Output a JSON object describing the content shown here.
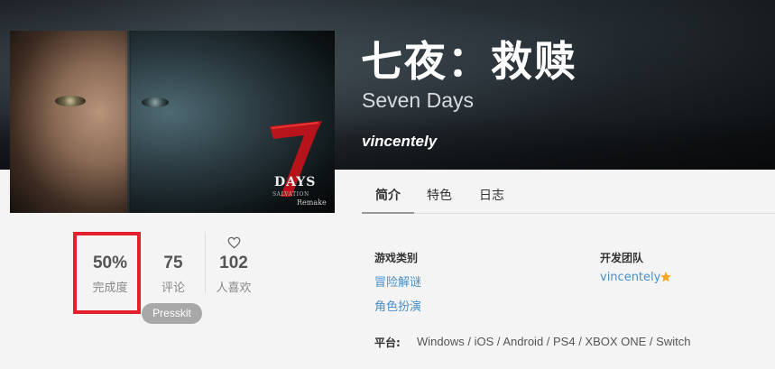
{
  "game": {
    "title": "七夜：救赎",
    "subtitle": "Seven Days",
    "author": "vincentely",
    "cover_logo": {
      "numeral": "7",
      "days": "DAYS",
      "sub": "SALVATION",
      "remake": "Remake"
    }
  },
  "tabs": [
    {
      "label": "简介",
      "active": true
    },
    {
      "label": "特色",
      "active": false
    },
    {
      "label": "日志",
      "active": false
    }
  ],
  "stats": {
    "completion": {
      "value": "50%",
      "label": "完成度"
    },
    "reviews": {
      "value": "75",
      "label": "评论"
    },
    "likes": {
      "value": "102",
      "label": "人喜欢"
    }
  },
  "presskit_label": "Presskit",
  "info": {
    "genre_heading": "游戏类别",
    "genres": [
      "冒险解谜",
      "角色扮演"
    ],
    "team_heading": "开发团队",
    "team_member": "vincentely",
    "platform_label": "平台:",
    "platforms": "Windows / iOS / Android / PS4 / XBOX ONE / Switch"
  },
  "colors": {
    "highlight": "#e3202b",
    "link": "#4a8fc9",
    "star": "#f5a623"
  },
  "icons": [
    "heart-icon",
    "star-icon"
  ]
}
